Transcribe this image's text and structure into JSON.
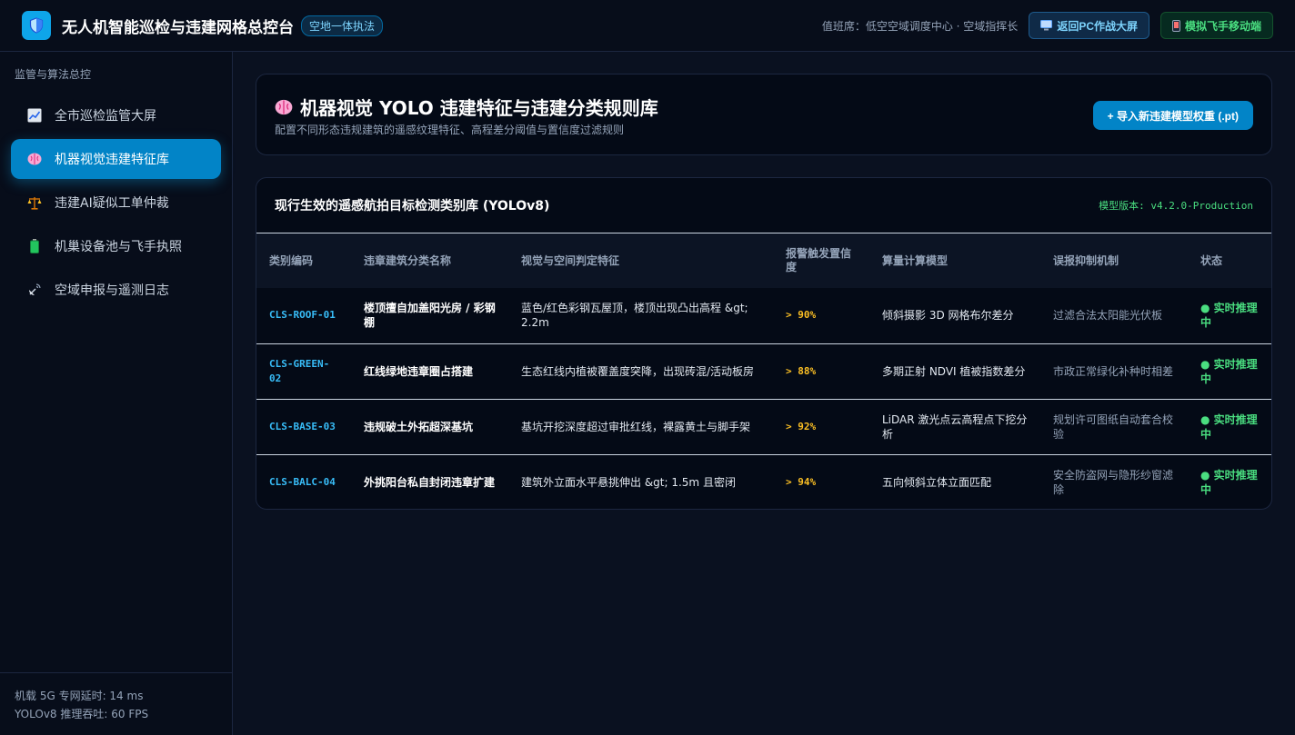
{
  "header": {
    "logo_icon": "shield-icon",
    "title": "无人机智能巡检与违建网格总控台",
    "badge": "空地一体执法",
    "duty": "值班席：低空空域调度中心 · 空域指挥长",
    "pc_button": "返回PC作战大屏",
    "pc_icon": "monitor-icon",
    "mobile_button": "模拟飞手移动端",
    "mobile_icon": "mobile-icon"
  },
  "sidebar": {
    "heading": "监管与算法总控",
    "items": [
      {
        "label": "全市巡检监管大屏",
        "icon": "chart-icon",
        "active": false
      },
      {
        "label": "机器视觉违建特征库",
        "icon": "brain-icon",
        "active": true
      },
      {
        "label": "违建AI疑似工单仲裁",
        "icon": "scales-icon",
        "active": false
      },
      {
        "label": "机巢设备池与飞手执照",
        "icon": "battery-icon",
        "active": false
      },
      {
        "label": "空域申报与遥测日志",
        "icon": "satellite-icon",
        "active": false
      }
    ],
    "footer_latency": "机载 5G 专网延时: 14 ms",
    "footer_fps": "YOLOv8 推理吞吐: 60 FPS"
  },
  "hero": {
    "icon": "brain-icon",
    "title": "机器视觉 YOLO 违建特征与违建分类规则库",
    "subtitle": "配置不同形态违规建筑的遥感纹理特征、高程差分阈值与置信度过滤规则",
    "import_button": "+ 导入新违建模型权重 (.pt)"
  },
  "panel": {
    "title": "现行生效的遥感航拍目标检测类别库 (YOLOv8)",
    "model_version": "模型版本: v4.2.0-Production",
    "columns": [
      "类别编码",
      "违章建筑分类名称",
      "视觉与空间判定特征",
      "报警触发置信度",
      "算量计算模型",
      "误报抑制机制",
      "状态"
    ],
    "rows": [
      {
        "code": "CLS-ROOF-01",
        "name": "楼顶擅自加盖阳光房 / 彩钢棚",
        "feature": "蓝色/红色彩钢瓦屋顶，楼顶出现凸出高程 &gt; 2.2m",
        "threshold": "> 90%",
        "model": "倾斜摄影 3D 网格布尔差分",
        "suppression": "过滤合法太阳能光伏板",
        "status": "● 实时推理中"
      },
      {
        "code": "CLS-GREEN-02",
        "name": "红线绿地违章圈占搭建",
        "feature": "生态红线内植被覆盖度突降，出现砖混/活动板房",
        "threshold": "> 88%",
        "model": "多期正射 NDVI 植被指数差分",
        "suppression": "市政正常绿化补种时相差",
        "status": "● 实时推理中"
      },
      {
        "code": "CLS-BASE-03",
        "name": "违规破土外拓超深基坑",
        "feature": "基坑开挖深度超过审批红线，裸露黄土与脚手架",
        "threshold": "> 92%",
        "model": "LiDAR 激光点云高程点下挖分析",
        "suppression": "规划许可图纸自动套合校验",
        "status": "● 实时推理中"
      },
      {
        "code": "CLS-BALC-04",
        "name": "外挑阳台私自封闭违章扩建",
        "feature": "建筑外立面水平悬挑伸出 &gt; 1.5m 且密闭",
        "threshold": "> 94%",
        "model": "五向倾斜立体立面匹配",
        "suppression": "安全防盗网与隐形纱窗滤除",
        "status": "● 实时推理中"
      }
    ]
  }
}
